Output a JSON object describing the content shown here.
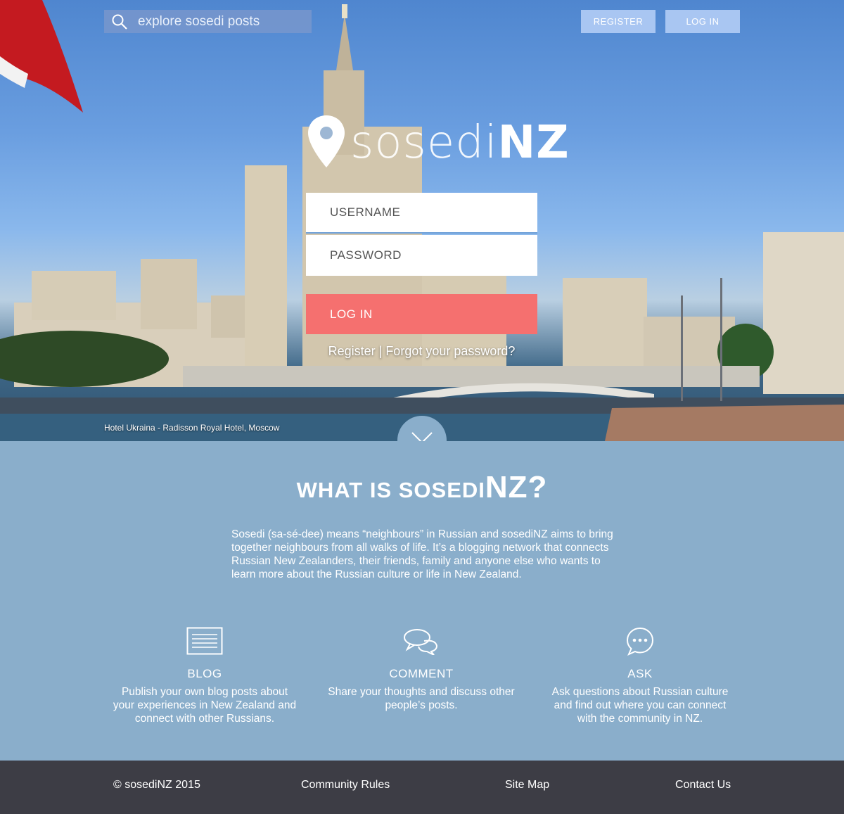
{
  "search": {
    "placeholder": "explore sosedi posts"
  },
  "header": {
    "register_label": "REGISTER",
    "login_label": "LOG IN"
  },
  "logo": {
    "light": "sosedi",
    "bold": "NZ"
  },
  "login_form": {
    "username_placeholder": "USERNAME",
    "password_placeholder": "PASSWORD",
    "submit_label": "LOG IN",
    "register_link": "Register",
    "separator": " | ",
    "forgot_link": "Forgot your password?"
  },
  "hero": {
    "caption": "Hotel Ukraina - Radisson Royal Hotel, Moscow"
  },
  "about": {
    "title_prefix": "What is sosedi",
    "title_suffix": "NZ?",
    "text": "Sosedi (sa-sé-dee) means “neighbours” in Russian and sosediNZ aims to bring together neighbours from all walks of life. It’s a blogging network that connects Russian New Zealanders, their friends, family and anyone else who wants to learn more about the Russian culture or life in New Zealand."
  },
  "features": [
    {
      "icon": "document-icon",
      "title": "BLOG",
      "text": "Publish your own blog posts about your experiences in New Zealand and connect with other Russians."
    },
    {
      "icon": "speech-bubbles-icon",
      "title": "COMMENT",
      "text": "Share your thoughts and discuss other people’s posts."
    },
    {
      "icon": "chat-dots-icon",
      "title": "ASK",
      "text": "Ask questions about Russian culture and find out where you can connect with the community in NZ."
    }
  ],
  "footer": {
    "copyright": "© sosediNZ 2015",
    "rules": "Community Rules",
    "sitemap": "Site Map",
    "contact": "Contact Us"
  },
  "colors": {
    "accent": "#f5706f",
    "section_bg": "#8aaecb",
    "footer_bg": "#3d3d45",
    "top_button": "#a9c6f2"
  }
}
